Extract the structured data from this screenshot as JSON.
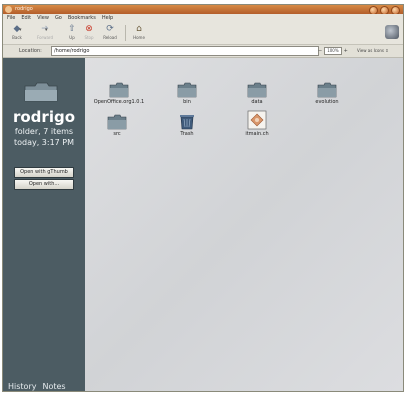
{
  "window": {
    "title": "rodrigo"
  },
  "menu": [
    "File",
    "Edit",
    "View",
    "Go",
    "Bookmarks",
    "Help"
  ],
  "toolbar": {
    "back": "Back",
    "forward": "Forward",
    "up": "Up",
    "stop": "Stop",
    "reload": "Reload",
    "home": "Home"
  },
  "location": {
    "label": "Location:",
    "value": "/home/rodrigo"
  },
  "zoom": {
    "value": "100%"
  },
  "view_as": "View as Icons",
  "sidebar": {
    "folder_name": "rodrigo",
    "info_line1": "folder, 7 items",
    "info_line2": "today, 3:17 PM",
    "open_with_app": "Open with gThumb",
    "open_with": "Open with...",
    "tabs": [
      "History",
      "Notes"
    ]
  },
  "files": [
    {
      "name": "OpenOffice.org1.0.1",
      "icon": "folder-icon"
    },
    {
      "name": "bin",
      "icon": "folder-icon"
    },
    {
      "name": "data",
      "icon": "folder-icon"
    },
    {
      "name": "evolution",
      "icon": "folder-icon"
    },
    {
      "name": "src",
      "icon": "folder-icon"
    },
    {
      "name": "Trash",
      "icon": "trash-icon"
    },
    {
      "name": "itmain.ch",
      "icon": "document-icon"
    }
  ],
  "colors": {
    "titlebar": "#c06a31",
    "sidebar": "#4c5c63",
    "folder": "#6b7f8a"
  }
}
